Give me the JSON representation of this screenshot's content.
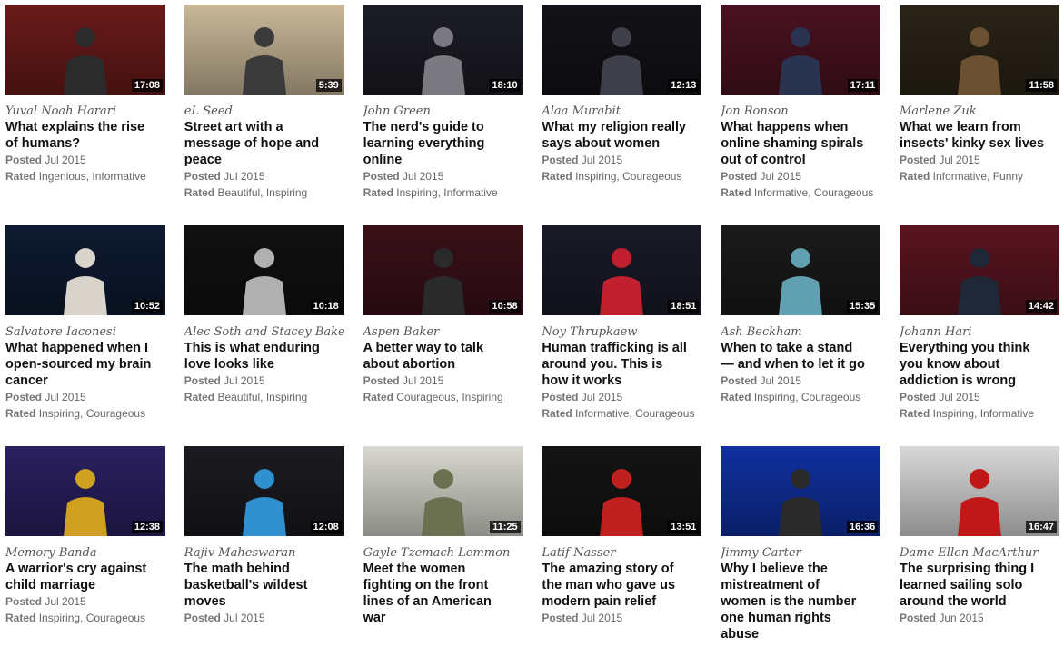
{
  "meta_labels": {
    "posted": "Posted",
    "rated": "Rated"
  },
  "talks": [
    {
      "speaker": "Yuval Noah Harari",
      "title": [
        "What explains the rise",
        "of humans?"
      ],
      "duration": "17:08",
      "posted": "Jul 2015",
      "rated": "Ingenious, Informative",
      "bg": "#6a1a1a",
      "fg": "#2b2b2b"
    },
    {
      "speaker": "eL Seed",
      "title": [
        "Street art with a",
        "message of hope and",
        "peace"
      ],
      "duration": "5:39",
      "posted": "Jul 2015",
      "rated": "Beautiful, Inspiring",
      "bg": "#c9b898",
      "fg": "#3a3a3a"
    },
    {
      "speaker": "John Green",
      "title": [
        "The nerd's guide to",
        "learning everything",
        "online"
      ],
      "duration": "18:10",
      "posted": "Jul 2015",
      "rated": "Inspiring, Informative",
      "bg": "#1c1c24",
      "fg": "#7a7a80"
    },
    {
      "speaker": "Alaa Murabit",
      "title": [
        "What my religion really",
        "says about women"
      ],
      "duration": "12:13",
      "posted": "Jul 2015",
      "rated": "Inspiring, Courageous",
      "bg": "#121218",
      "fg": "#40404a"
    },
    {
      "speaker": "Jon Ronson",
      "title": [
        "What happens when",
        "online shaming spirals",
        "out of control"
      ],
      "duration": "17:11",
      "posted": "Jul 2015",
      "rated": "Informative, Courageous",
      "bg": "#4a1220",
      "fg": "#2a3450"
    },
    {
      "speaker": "Marlene Zuk",
      "title": [
        "What we learn from",
        "insects' kinky sex lives"
      ],
      "duration": "11:58",
      "posted": "Jul 2015",
      "rated": "Informative, Funny",
      "bg": "#2a2418",
      "fg": "#6a5030"
    },
    {
      "speaker": "Salvatore Iaconesi",
      "title": [
        "What happened when I",
        "open-sourced my brain",
        "cancer"
      ],
      "duration": "10:52",
      "posted": "Jul 2015",
      "rated": "Inspiring, Courageous",
      "bg": "#0e1a30",
      "fg": "#d8d4cc"
    },
    {
      "speaker": "Alec Soth and Stacey Baker",
      "title": [
        "This is what enduring",
        "love looks like"
      ],
      "duration": "10:18",
      "posted": "Jul 2015",
      "rated": "Beautiful, Inspiring",
      "bg": "#101010",
      "fg": "#b0b0b0"
    },
    {
      "speaker": "Aspen Baker",
      "title": [
        "A better way to talk",
        "about abortion"
      ],
      "duration": "10:58",
      "posted": "Jul 2015",
      "rated": "Courageous, Inspiring",
      "bg": "#3a1018",
      "fg": "#2a2a2a"
    },
    {
      "speaker": "Noy Thrupkaew",
      "title": [
        "Human trafficking is all",
        "around you. This is",
        "how it works"
      ],
      "duration": "18:51",
      "posted": "Jul 2015",
      "rated": "Informative, Courageous",
      "bg": "#1a1a28",
      "fg": "#c02030"
    },
    {
      "speaker": "Ash Beckham",
      "title": [
        "When to take a stand",
        "— and when to let it go"
      ],
      "duration": "15:35",
      "posted": "Jul 2015",
      "rated": "Inspiring, Courageous",
      "bg": "#1a1a1a",
      "fg": "#60a0b0"
    },
    {
      "speaker": "Johann Hari",
      "title": [
        "Everything you think",
        "you know about",
        "addiction is wrong"
      ],
      "duration": "14:42",
      "posted": "Jul 2015",
      "rated": "Inspiring, Informative",
      "bg": "#5a1420",
      "fg": "#202838"
    },
    {
      "speaker": "Memory Banda",
      "title": [
        "A warrior's cry against",
        "child marriage"
      ],
      "duration": "12:38",
      "posted": "Jul 2015",
      "rated": "Inspiring, Courageous",
      "bg": "#2a2060",
      "fg": "#d0a020"
    },
    {
      "speaker": "Rajiv Maheswaran",
      "title": [
        "The math behind",
        "basketball's wildest",
        "moves"
      ],
      "duration": "12:08",
      "posted": "Jul 2015",
      "rated": "",
      "bg": "#1a1a20",
      "fg": "#3090d0"
    },
    {
      "speaker": "Gayle Tzemach Lemmon",
      "title": [
        "Meet the women",
        "fighting on the front",
        "lines of an American",
        "war"
      ],
      "duration": "11:25",
      "posted": "",
      "rated": "",
      "bg": "#d8d8d0",
      "fg": "#6a7050"
    },
    {
      "speaker": "Latif Nasser",
      "title": [
        "The amazing story of",
        "the man who gave us",
        "modern pain relief"
      ],
      "duration": "13:51",
      "posted": "Jul 2015",
      "rated": "",
      "bg": "#141414",
      "fg": "#c02020"
    },
    {
      "speaker": "Jimmy Carter",
      "title": [
        "Why I believe the",
        "mistreatment of",
        "women is the number",
        "one human rights",
        "abuse"
      ],
      "duration": "16:36",
      "posted": "",
      "rated": "",
      "bg": "#1030a0",
      "fg": "#2a2a2a"
    },
    {
      "speaker": "Dame Ellen MacArthur",
      "title": [
        "The surprising thing I",
        "learned sailing solo",
        "around the world"
      ],
      "duration": "16:47",
      "posted": "Jun 2015",
      "rated": "",
      "bg": "#d8d8d8",
      "fg": "#c01818"
    }
  ]
}
